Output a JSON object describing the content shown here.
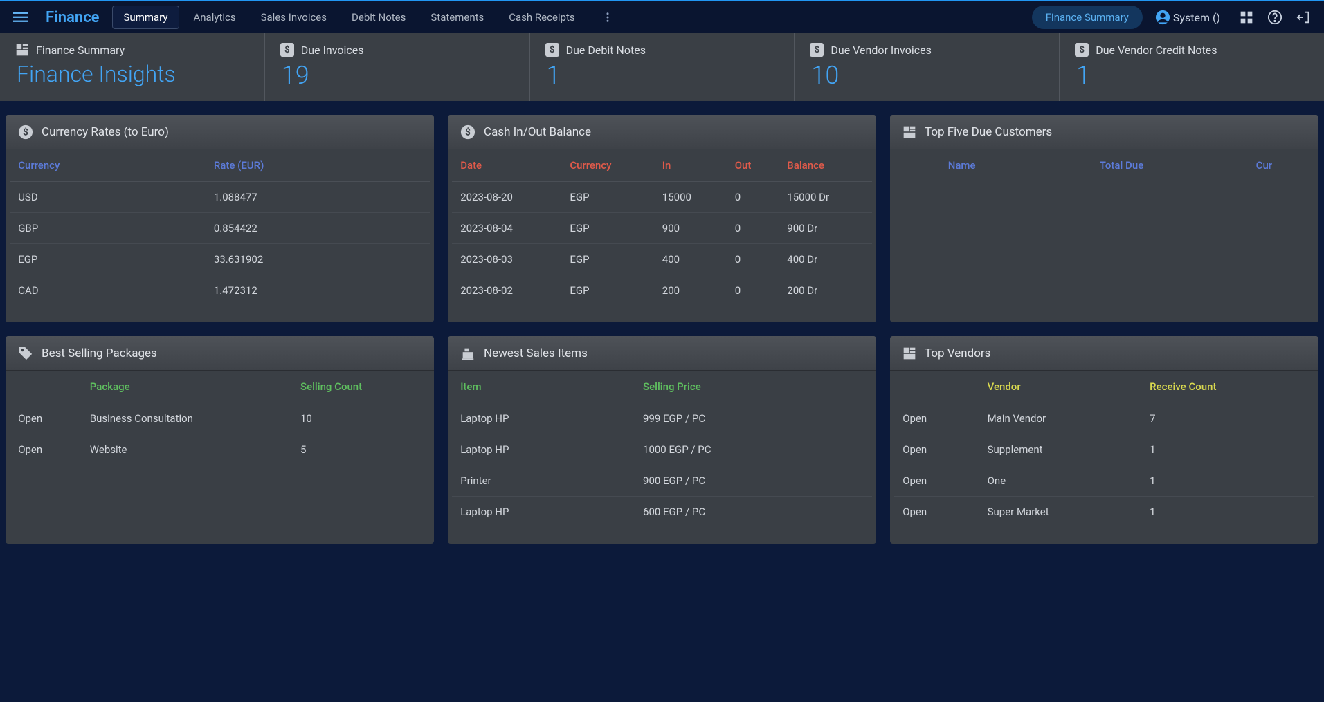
{
  "header": {
    "brand": "Finance",
    "tabs": [
      "Summary",
      "Analytics",
      "Sales Invoices",
      "Debit Notes",
      "Statements",
      "Cash Receipts"
    ],
    "active_tab": 0,
    "chip": "Finance Summary",
    "user": "System ()"
  },
  "stats": {
    "title_label": "Finance Summary",
    "title_big": "Finance Insights",
    "items": [
      {
        "label": "Due Invoices",
        "value": "19"
      },
      {
        "label": "Due Debit Notes",
        "value": "1"
      },
      {
        "label": "Due Vendor Invoices",
        "value": "10"
      },
      {
        "label": "Due Vendor Credit Notes",
        "value": "1"
      }
    ]
  },
  "panels": {
    "currency": {
      "title": "Currency Rates (to Euro)",
      "cols": [
        "Currency",
        "Rate (EUR)"
      ],
      "rows": [
        [
          "USD",
          "1.088477"
        ],
        [
          "GBP",
          "0.854422"
        ],
        [
          "EGP",
          "33.631902"
        ],
        [
          "CAD",
          "1.472312"
        ]
      ]
    },
    "cash": {
      "title": "Cash In/Out Balance",
      "cols": [
        "Date",
        "Currency",
        "In",
        "Out",
        "Balance"
      ],
      "rows": [
        [
          "2023-08-20",
          "EGP",
          "15000",
          "0",
          "15000 Dr"
        ],
        [
          "2023-08-04",
          "EGP",
          "900",
          "0",
          "900 Dr"
        ],
        [
          "2023-08-03",
          "EGP",
          "400",
          "0",
          "400 Dr"
        ],
        [
          "2023-08-02",
          "EGP",
          "200",
          "0",
          "200 Dr"
        ]
      ]
    },
    "topcust": {
      "title": "Top Five Due Customers",
      "cols": [
        "Name",
        "Total Due",
        "Cur"
      ],
      "rows": []
    },
    "packages": {
      "title": "Best Selling Packages",
      "cols": [
        "",
        "Package",
        "Selling Count"
      ],
      "rows": [
        [
          "Open",
          "Business Consultation",
          "10"
        ],
        [
          "Open",
          "Website",
          "5"
        ]
      ]
    },
    "newest": {
      "title": "Newest Sales Items",
      "cols": [
        "Item",
        "Selling Price"
      ],
      "rows": [
        [
          "Laptop HP",
          "999 EGP / PC"
        ],
        [
          "Laptop HP",
          "1000 EGP / PC"
        ],
        [
          "Printer",
          "900 EGP / PC"
        ],
        [
          "Laptop HP",
          "600 EGP / PC"
        ]
      ]
    },
    "vendors": {
      "title": "Top Vendors",
      "cols": [
        "",
        "Vendor",
        "Receive Count"
      ],
      "rows": [
        [
          "Open",
          "Main Vendor",
          "7"
        ],
        [
          "Open",
          "Supplement",
          "1"
        ],
        [
          "Open",
          "One",
          "1"
        ],
        [
          "Open",
          "Super Market",
          "1"
        ]
      ]
    }
  }
}
